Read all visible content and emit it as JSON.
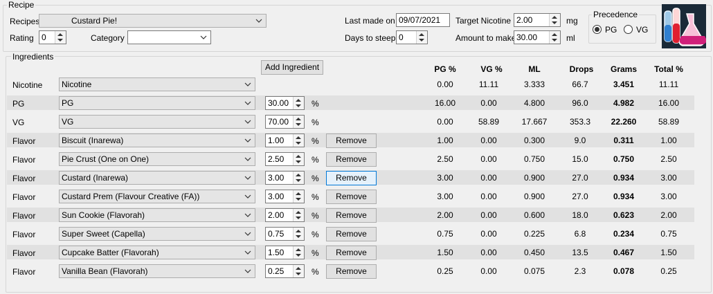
{
  "recipe_group_title": "Recipe",
  "recipes_label": "Recipes",
  "recipe_value": "Custard Pie!",
  "rating_label": "Rating",
  "rating_value": "0",
  "category_label": "Category",
  "category_value": "",
  "last_made_label": "Last made on",
  "last_made_value": "09/07/2021",
  "days_to_steep_label": "Days to steep",
  "days_to_steep_value": "0",
  "target_nicotine_label": "Target Nicotine",
  "target_nicotine_value": "2.00",
  "target_nicotine_unit": "mg",
  "amount_label": "Amount to make",
  "amount_value": "30.00",
  "amount_unit": "ml",
  "precedence_title": "Precedence",
  "pg_option": "PG",
  "vg_option": "VG",
  "ingredients_group_title": "Ingredients",
  "add_ingredient_label": "Add Ingredient",
  "columns": [
    "PG %",
    "VG %",
    "ML",
    "Drops",
    "Grams",
    "Total %"
  ],
  "remove_label": "Remove",
  "percent_sign": "%",
  "rows": [
    {
      "type": "Nicotine",
      "name": "Nicotine",
      "pct": "",
      "pg": "0.00",
      "vg": "11.11",
      "ml": "3.333",
      "drops": "66.7",
      "grams": "3.451",
      "total": "11.11"
    },
    {
      "type": "PG",
      "name": "PG",
      "pct": "30.00",
      "pg": "16.00",
      "vg": "0.00",
      "ml": "4.800",
      "drops": "96.0",
      "grams": "4.982",
      "total": "16.00"
    },
    {
      "type": "VG",
      "name": "VG",
      "pct": "70.00",
      "pg": "0.00",
      "vg": "58.89",
      "ml": "17.667",
      "drops": "353.3",
      "grams": "22.260",
      "total": "58.89"
    },
    {
      "type": "Flavor",
      "name": "Biscuit (Inarewa)",
      "pct": "1.00",
      "pg": "1.00",
      "vg": "0.00",
      "ml": "0.300",
      "drops": "9.0",
      "grams": "0.311",
      "total": "1.00"
    },
    {
      "type": "Flavor",
      "name": "Pie Crust (One on One)",
      "pct": "2.50",
      "pg": "2.50",
      "vg": "0.00",
      "ml": "0.750",
      "drops": "15.0",
      "grams": "0.750",
      "total": "2.50"
    },
    {
      "type": "Flavor",
      "name": "Custard (Inarewa)",
      "pct": "3.00",
      "pg": "3.00",
      "vg": "0.00",
      "ml": "0.900",
      "drops": "27.0",
      "grams": "0.934",
      "total": "3.00"
    },
    {
      "type": "Flavor",
      "name": "Custard Prem (Flavour Creative (FA))",
      "pct": "3.00",
      "pg": "3.00",
      "vg": "0.00",
      "ml": "0.900",
      "drops": "27.0",
      "grams": "0.934",
      "total": "3.00"
    },
    {
      "type": "Flavor",
      "name": "Sun Cookie (Flavorah)",
      "pct": "2.00",
      "pg": "2.00",
      "vg": "0.00",
      "ml": "0.600",
      "drops": "18.0",
      "grams": "0.623",
      "total": "2.00"
    },
    {
      "type": "Flavor",
      "name": "Super Sweet (Capella)",
      "pct": "0.75",
      "pg": "0.75",
      "vg": "0.00",
      "ml": "0.225",
      "drops": "6.8",
      "grams": "0.234",
      "total": "0.75"
    },
    {
      "type": "Flavor",
      "name": "Cupcake Batter (Flavorah)",
      "pct": "1.50",
      "pg": "1.50",
      "vg": "0.00",
      "ml": "0.450",
      "drops": "13.5",
      "grams": "0.467",
      "total": "1.50"
    },
    {
      "type": "Flavor",
      "name": "Vanilla Bean (Flavorah)",
      "pct": "0.25",
      "pg": "0.25",
      "vg": "0.00",
      "ml": "0.075",
      "drops": "2.3",
      "grams": "0.078",
      "total": "0.25"
    }
  ]
}
